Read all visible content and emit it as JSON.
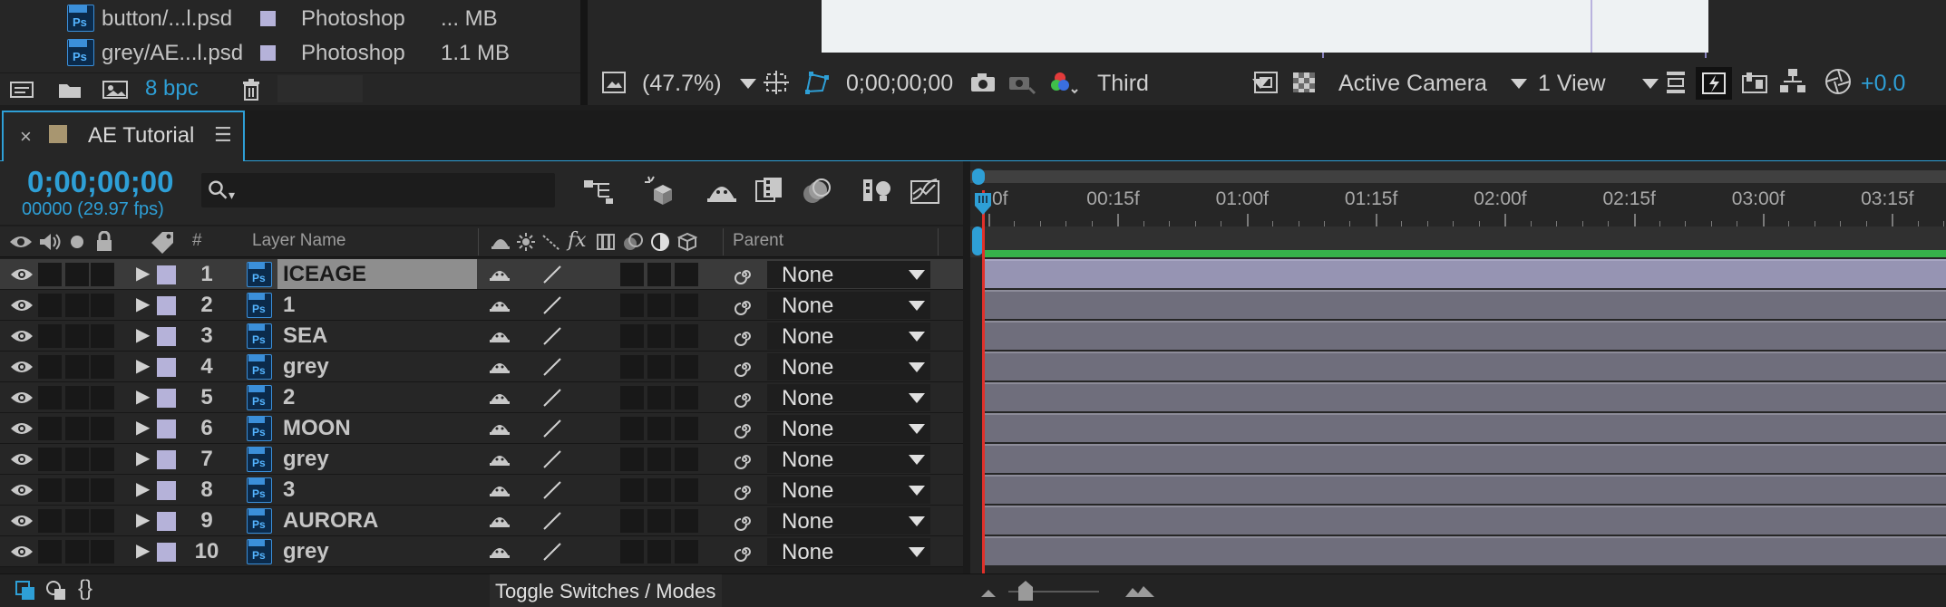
{
  "project_panel": {
    "items": [
      {
        "name": "button/...l.psd",
        "type": "Photoshop",
        "size": "... MB"
      },
      {
        "name": "grey/AE...l.psd",
        "type": "Photoshop",
        "size": "1.1 MB"
      }
    ],
    "bpc": "8 bpc",
    "label_color": "#b5b2d9"
  },
  "viewer": {
    "zoom": "(47.7%)",
    "timecode": "0;00;00;00",
    "resolution": "Third",
    "camera": "Active Camera",
    "views": "1 View",
    "exposure": "+0.0"
  },
  "tab": {
    "close": "×",
    "title": "AE Tutorial",
    "menu": "☰"
  },
  "timeline": {
    "timecode": "0;00;00;00",
    "frame_info": "00000 (29.97 fps)",
    "search_icon": "⚲",
    "columns": {
      "hash": "#",
      "layer_name": "Layer Name",
      "parent": "Parent"
    },
    "ruler": [
      "0f",
      "00:15f",
      "01:00f",
      "01:15f",
      "02:00f",
      "02:15f",
      "03:00f",
      "03:15f"
    ],
    "layers": [
      {
        "num": "1",
        "name": "ICEAGE",
        "parent": "None",
        "selected": true
      },
      {
        "num": "2",
        "name": "1",
        "parent": "None"
      },
      {
        "num": "3",
        "name": "SEA",
        "parent": "None"
      },
      {
        "num": "4",
        "name": "grey",
        "parent": "None"
      },
      {
        "num": "5",
        "name": "2",
        "parent": "None"
      },
      {
        "num": "6",
        "name": "MOON",
        "parent": "None"
      },
      {
        "num": "7",
        "name": "grey",
        "parent": "None"
      },
      {
        "num": "8",
        "name": "3",
        "parent": "None"
      },
      {
        "num": "9",
        "name": "AURORA",
        "parent": "None"
      },
      {
        "num": "10",
        "name": "grey",
        "parent": "None"
      }
    ],
    "toggle_label": "Toggle Switches / Modes",
    "accent": "#2e9fd6",
    "bar_color": "#6f6e7c",
    "work_area_color": "#36b24a",
    "playhead_color": "#e0302a"
  }
}
